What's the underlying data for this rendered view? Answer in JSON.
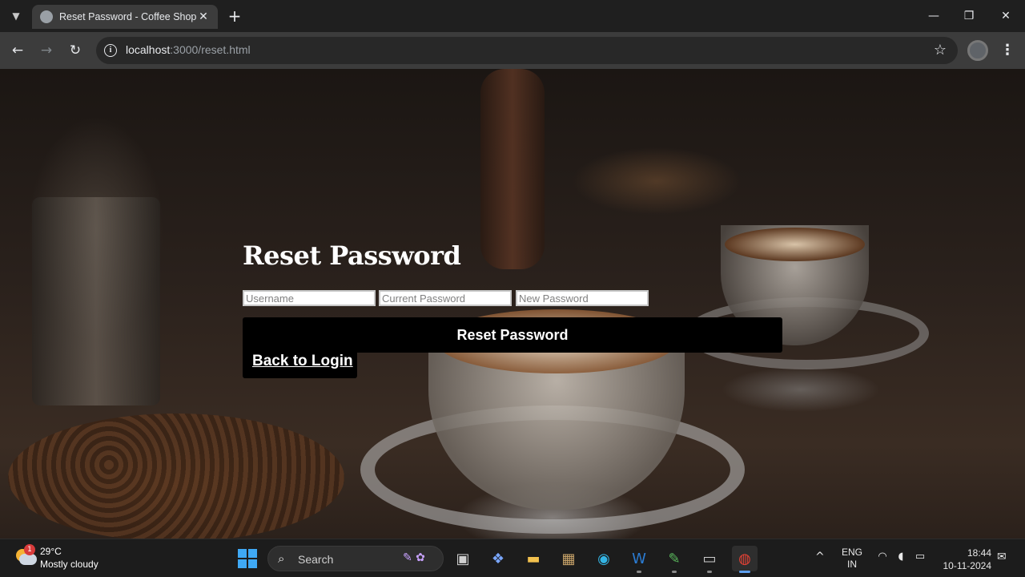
{
  "browser": {
    "tab_title": "Reset Password - Coffee Shop",
    "tab_close": "✕",
    "new_tab": "+",
    "url_host": "localhost",
    "url_path": ":3000/reset.html",
    "icons": {
      "tab_search": "chevron-down-icon",
      "favicon": "globe-icon",
      "back": "arrow-left-icon",
      "forward": "arrow-right-icon",
      "reload": "reload-icon",
      "info": "info-icon",
      "bookmark": "star-icon",
      "profile": "avatar",
      "menu": "kebab-menu-icon",
      "minimize": "minimize-icon",
      "restore": "restore-icon",
      "close": "close-icon"
    }
  },
  "page": {
    "heading": "Reset Password",
    "fields": {
      "username_placeholder": "Username",
      "current_password_placeholder": "Current Password",
      "new_password_placeholder": "New Password"
    },
    "submit_label": "Reset Password",
    "back_link": "Back to Login",
    "colors": {
      "button_bg": "#000000",
      "button_text": "#ffffff",
      "heading_text": "#ffffff"
    }
  },
  "taskbar": {
    "weather": {
      "temp": "29°C",
      "description": "Mostly cloudy",
      "badge": "1"
    },
    "search_label": "Search",
    "apps": [
      "task-view-icon",
      "copilot-icon",
      "file-explorer-icon",
      "package-app-icon",
      "edge-icon",
      "word-icon",
      "notepad-icon",
      "terminal-icon",
      "chrome-icon"
    ],
    "language_line1": "ENG",
    "language_line2": "IN",
    "time": "18:44",
    "date": "10-11-2024"
  }
}
